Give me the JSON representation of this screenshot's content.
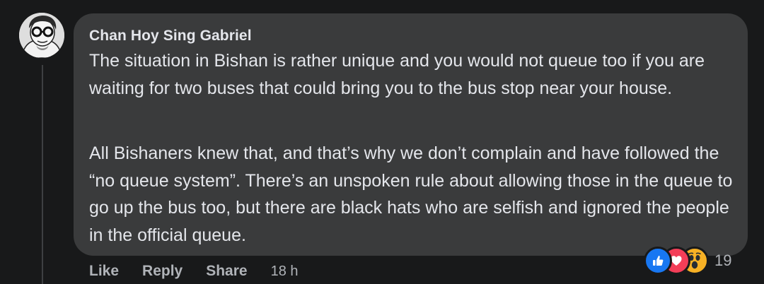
{
  "comment": {
    "author": "Chan Hoy Sing Gabriel",
    "paragraphs": [
      "The situation in Bishan is rather unique and you would not queue too if you are waiting for two buses that could bring you to the bus stop near your house.",
      "All Bishaners knew that, and that’s why we don’t complain and have followed the “no queue system”. There’s an unspoken rule about allowing those in the queue to go up the bus too, but there are black hats who are selfish and ignored the people in the official queue."
    ],
    "reactions": {
      "icons": [
        "like-icon",
        "heart-icon",
        "wow-icon"
      ],
      "count": "19"
    },
    "actions": {
      "like": "Like",
      "reply": "Reply",
      "share": "Share"
    },
    "timestamp": "18 h"
  },
  "colors": {
    "background": "#18191a",
    "bubble": "#3a3b3c",
    "text": "#e4e6eb",
    "secondary_text": "#b0b3b8",
    "like_blue": "#1877f2",
    "love_red": "#f33e58",
    "wow_yellow": "#f7b125"
  }
}
